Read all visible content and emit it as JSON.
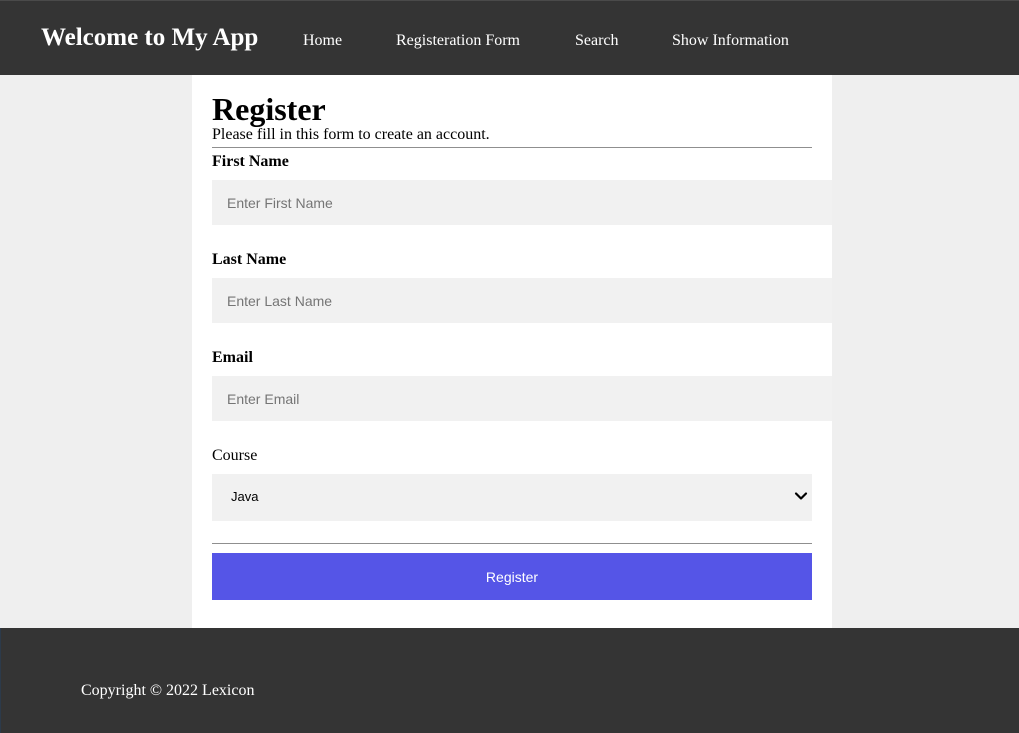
{
  "header": {
    "brand": "Welcome to My App",
    "nav": [
      {
        "label": "Home"
      },
      {
        "label": "Registeration Form"
      },
      {
        "label": "Search"
      },
      {
        "label": "Show Information"
      }
    ]
  },
  "form": {
    "title": "Register",
    "subtitle": "Please fill in this form to create an account.",
    "first_name": {
      "label": "First Name",
      "placeholder": "Enter First Name",
      "value": ""
    },
    "last_name": {
      "label": "Last Name",
      "placeholder": "Enter Last Name",
      "value": ""
    },
    "email": {
      "label": "Email",
      "placeholder": "Enter Email",
      "value": ""
    },
    "course": {
      "label": "Course",
      "selected": "Java",
      "icon": "chevron-down-icon"
    },
    "submit_label": "Register"
  },
  "footer": {
    "copyright": "Copyright © 2022 Lexicon"
  },
  "colors": {
    "bar": "#343434",
    "page_bg": "#efefef",
    "input_bg": "#f1f1f1",
    "accent": "#5555e7"
  }
}
